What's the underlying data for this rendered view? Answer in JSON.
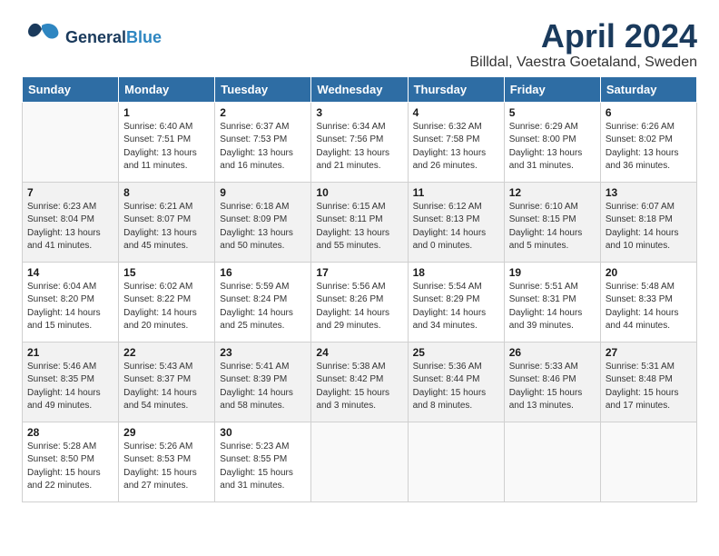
{
  "header": {
    "logo_general": "General",
    "logo_blue": "Blue",
    "month_year": "April 2024",
    "location": "Billdal, Vaestra Goetaland, Sweden"
  },
  "weekdays": [
    "Sunday",
    "Monday",
    "Tuesday",
    "Wednesday",
    "Thursday",
    "Friday",
    "Saturday"
  ],
  "weeks": [
    [
      {
        "day": "",
        "sunrise": "",
        "sunset": "",
        "daylight": ""
      },
      {
        "day": "1",
        "sunrise": "Sunrise: 6:40 AM",
        "sunset": "Sunset: 7:51 PM",
        "daylight": "Daylight: 13 hours and 11 minutes."
      },
      {
        "day": "2",
        "sunrise": "Sunrise: 6:37 AM",
        "sunset": "Sunset: 7:53 PM",
        "daylight": "Daylight: 13 hours and 16 minutes."
      },
      {
        "day": "3",
        "sunrise": "Sunrise: 6:34 AM",
        "sunset": "Sunset: 7:56 PM",
        "daylight": "Daylight: 13 hours and 21 minutes."
      },
      {
        "day": "4",
        "sunrise": "Sunrise: 6:32 AM",
        "sunset": "Sunset: 7:58 PM",
        "daylight": "Daylight: 13 hours and 26 minutes."
      },
      {
        "day": "5",
        "sunrise": "Sunrise: 6:29 AM",
        "sunset": "Sunset: 8:00 PM",
        "daylight": "Daylight: 13 hours and 31 minutes."
      },
      {
        "day": "6",
        "sunrise": "Sunrise: 6:26 AM",
        "sunset": "Sunset: 8:02 PM",
        "daylight": "Daylight: 13 hours and 36 minutes."
      }
    ],
    [
      {
        "day": "7",
        "sunrise": "Sunrise: 6:23 AM",
        "sunset": "Sunset: 8:04 PM",
        "daylight": "Daylight: 13 hours and 41 minutes."
      },
      {
        "day": "8",
        "sunrise": "Sunrise: 6:21 AM",
        "sunset": "Sunset: 8:07 PM",
        "daylight": "Daylight: 13 hours and 45 minutes."
      },
      {
        "day": "9",
        "sunrise": "Sunrise: 6:18 AM",
        "sunset": "Sunset: 8:09 PM",
        "daylight": "Daylight: 13 hours and 50 minutes."
      },
      {
        "day": "10",
        "sunrise": "Sunrise: 6:15 AM",
        "sunset": "Sunset: 8:11 PM",
        "daylight": "Daylight: 13 hours and 55 minutes."
      },
      {
        "day": "11",
        "sunrise": "Sunrise: 6:12 AM",
        "sunset": "Sunset: 8:13 PM",
        "daylight": "Daylight: 14 hours and 0 minutes."
      },
      {
        "day": "12",
        "sunrise": "Sunrise: 6:10 AM",
        "sunset": "Sunset: 8:15 PM",
        "daylight": "Daylight: 14 hours and 5 minutes."
      },
      {
        "day": "13",
        "sunrise": "Sunrise: 6:07 AM",
        "sunset": "Sunset: 8:18 PM",
        "daylight": "Daylight: 14 hours and 10 minutes."
      }
    ],
    [
      {
        "day": "14",
        "sunrise": "Sunrise: 6:04 AM",
        "sunset": "Sunset: 8:20 PM",
        "daylight": "Daylight: 14 hours and 15 minutes."
      },
      {
        "day": "15",
        "sunrise": "Sunrise: 6:02 AM",
        "sunset": "Sunset: 8:22 PM",
        "daylight": "Daylight: 14 hours and 20 minutes."
      },
      {
        "day": "16",
        "sunrise": "Sunrise: 5:59 AM",
        "sunset": "Sunset: 8:24 PM",
        "daylight": "Daylight: 14 hours and 25 minutes."
      },
      {
        "day": "17",
        "sunrise": "Sunrise: 5:56 AM",
        "sunset": "Sunset: 8:26 PM",
        "daylight": "Daylight: 14 hours and 29 minutes."
      },
      {
        "day": "18",
        "sunrise": "Sunrise: 5:54 AM",
        "sunset": "Sunset: 8:29 PM",
        "daylight": "Daylight: 14 hours and 34 minutes."
      },
      {
        "day": "19",
        "sunrise": "Sunrise: 5:51 AM",
        "sunset": "Sunset: 8:31 PM",
        "daylight": "Daylight: 14 hours and 39 minutes."
      },
      {
        "day": "20",
        "sunrise": "Sunrise: 5:48 AM",
        "sunset": "Sunset: 8:33 PM",
        "daylight": "Daylight: 14 hours and 44 minutes."
      }
    ],
    [
      {
        "day": "21",
        "sunrise": "Sunrise: 5:46 AM",
        "sunset": "Sunset: 8:35 PM",
        "daylight": "Daylight: 14 hours and 49 minutes."
      },
      {
        "day": "22",
        "sunrise": "Sunrise: 5:43 AM",
        "sunset": "Sunset: 8:37 PM",
        "daylight": "Daylight: 14 hours and 54 minutes."
      },
      {
        "day": "23",
        "sunrise": "Sunrise: 5:41 AM",
        "sunset": "Sunset: 8:39 PM",
        "daylight": "Daylight: 14 hours and 58 minutes."
      },
      {
        "day": "24",
        "sunrise": "Sunrise: 5:38 AM",
        "sunset": "Sunset: 8:42 PM",
        "daylight": "Daylight: 15 hours and 3 minutes."
      },
      {
        "day": "25",
        "sunrise": "Sunrise: 5:36 AM",
        "sunset": "Sunset: 8:44 PM",
        "daylight": "Daylight: 15 hours and 8 minutes."
      },
      {
        "day": "26",
        "sunrise": "Sunrise: 5:33 AM",
        "sunset": "Sunset: 8:46 PM",
        "daylight": "Daylight: 15 hours and 13 minutes."
      },
      {
        "day": "27",
        "sunrise": "Sunrise: 5:31 AM",
        "sunset": "Sunset: 8:48 PM",
        "daylight": "Daylight: 15 hours and 17 minutes."
      }
    ],
    [
      {
        "day": "28",
        "sunrise": "Sunrise: 5:28 AM",
        "sunset": "Sunset: 8:50 PM",
        "daylight": "Daylight: 15 hours and 22 minutes."
      },
      {
        "day": "29",
        "sunrise": "Sunrise: 5:26 AM",
        "sunset": "Sunset: 8:53 PM",
        "daylight": "Daylight: 15 hours and 27 minutes."
      },
      {
        "day": "30",
        "sunrise": "Sunrise: 5:23 AM",
        "sunset": "Sunset: 8:55 PM",
        "daylight": "Daylight: 15 hours and 31 minutes."
      },
      {
        "day": "",
        "sunrise": "",
        "sunset": "",
        "daylight": ""
      },
      {
        "day": "",
        "sunrise": "",
        "sunset": "",
        "daylight": ""
      },
      {
        "day": "",
        "sunrise": "",
        "sunset": "",
        "daylight": ""
      },
      {
        "day": "",
        "sunrise": "",
        "sunset": "",
        "daylight": ""
      }
    ]
  ]
}
